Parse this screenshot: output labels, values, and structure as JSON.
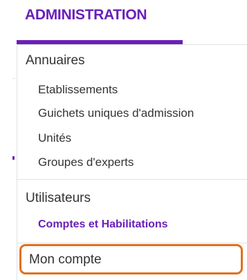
{
  "header": {
    "title": "ADMINISTRATION"
  },
  "menu": {
    "annuaires": {
      "label": "Annuaires",
      "items": [
        "Etablissements",
        "Guichets uniques d'admission",
        "Unités",
        "Groupes d'experts"
      ]
    },
    "utilisateurs": {
      "label": "Utilisateurs",
      "items": [
        "Comptes et Habilitations"
      ]
    },
    "mon_compte": {
      "label": "Mon compte"
    }
  },
  "colors": {
    "accent": "#6a1fb8",
    "focus": "#e0701c",
    "text": "#333333",
    "divider": "#e2e2e2"
  }
}
